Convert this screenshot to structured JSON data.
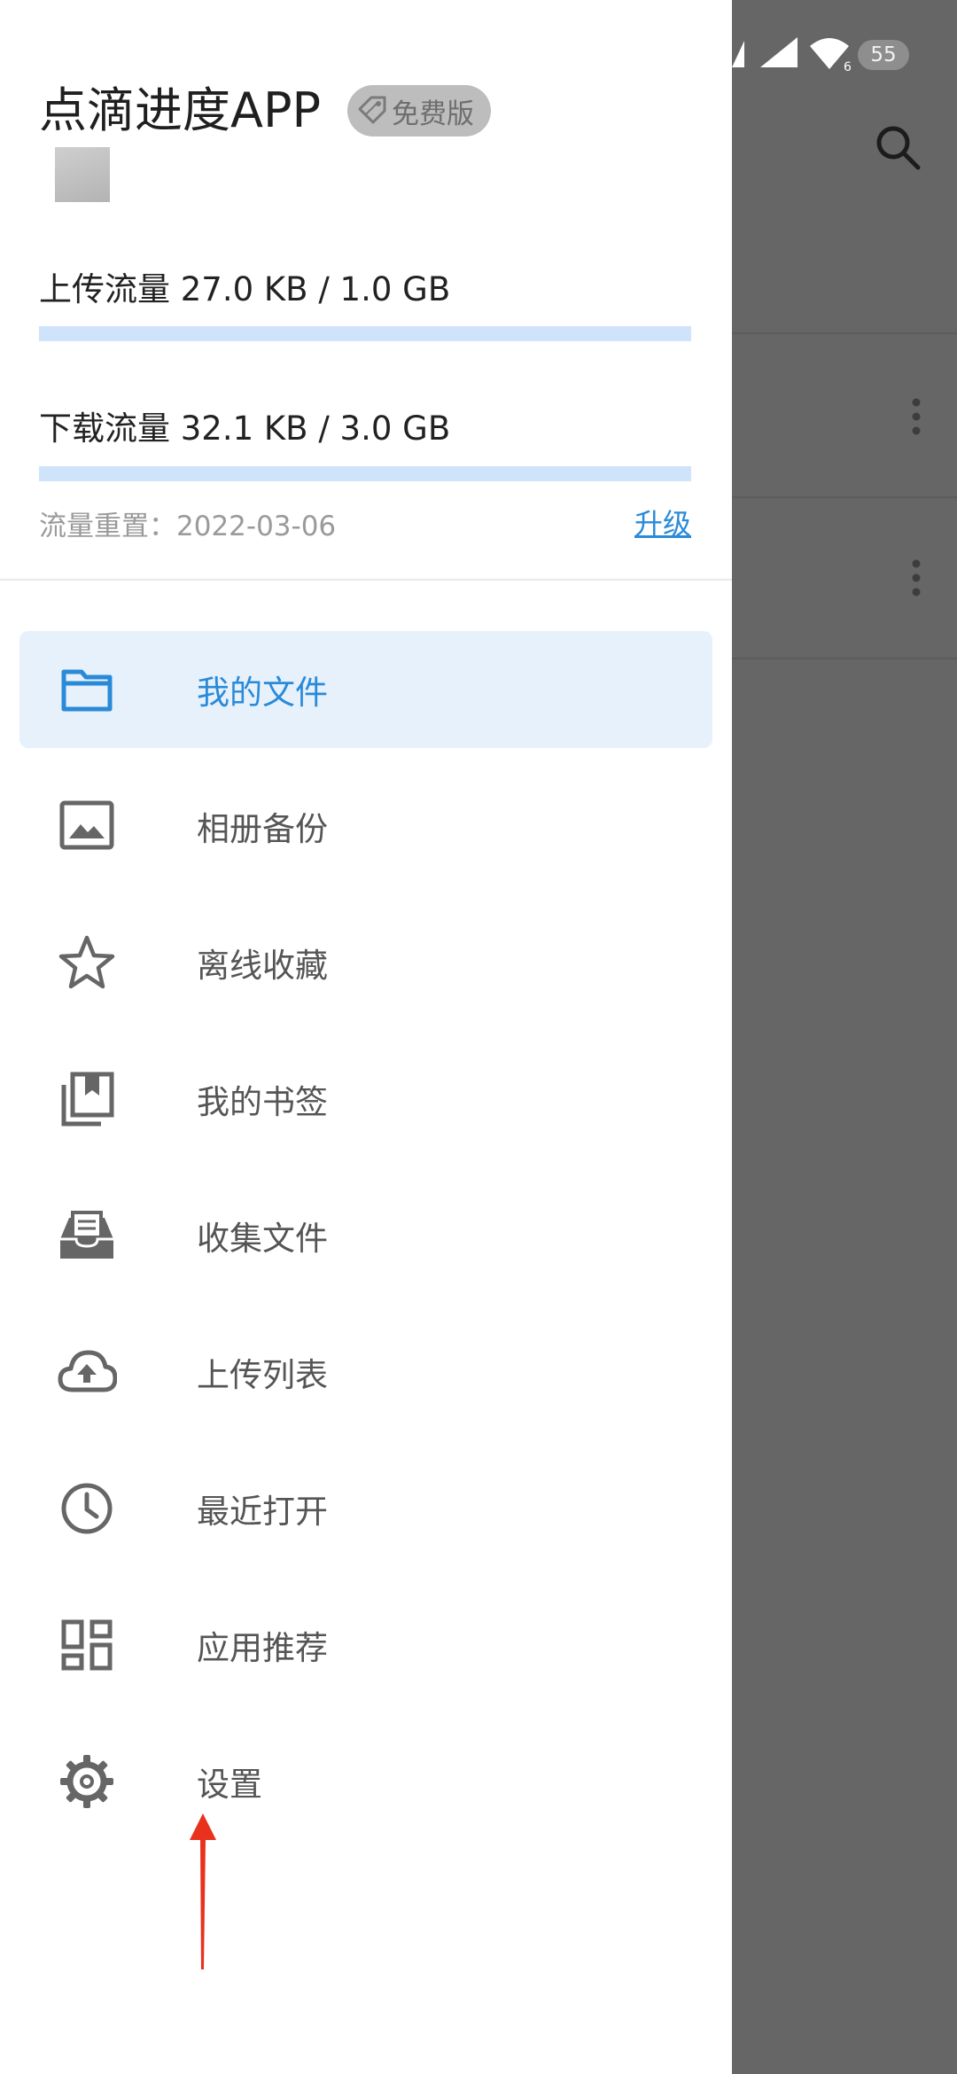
{
  "status_bar": {
    "battery_level": "55"
  },
  "drawer": {
    "app_title": "点滴进度APP",
    "plan_badge": "免费版",
    "upload": {
      "label": "上传流量 27.0 KB / 1.0 GB",
      "used_fraction": 2.51e-05
    },
    "download": {
      "label": "下载流量 32.1 KB / 3.0 GB",
      "used_fraction": 1.02e-05
    },
    "reset_text": "流量重置：2022-03-06",
    "upgrade_label": "升级",
    "menu": [
      {
        "label": "我的文件",
        "icon": "folder-icon",
        "active": true
      },
      {
        "label": "相册备份",
        "icon": "image-icon",
        "active": false
      },
      {
        "label": "离线收藏",
        "icon": "star-icon",
        "active": false
      },
      {
        "label": "我的书签",
        "icon": "bookmarks-icon",
        "active": false
      },
      {
        "label": "收集文件",
        "icon": "inbox-icon",
        "active": false
      },
      {
        "label": "上传列表",
        "icon": "cloud-upload-icon",
        "active": false
      },
      {
        "label": "最近打开",
        "icon": "clock-icon",
        "active": false
      },
      {
        "label": "应用推荐",
        "icon": "dashboard-icon",
        "active": false
      },
      {
        "label": "设置",
        "icon": "gear-icon",
        "active": false
      }
    ]
  },
  "colors": {
    "accent": "#2a8ad8",
    "active_background": "#e6f1fc",
    "quota_track": "#cfe3fb",
    "scrim": "#666666",
    "annotation_arrow": "#e8321e"
  }
}
